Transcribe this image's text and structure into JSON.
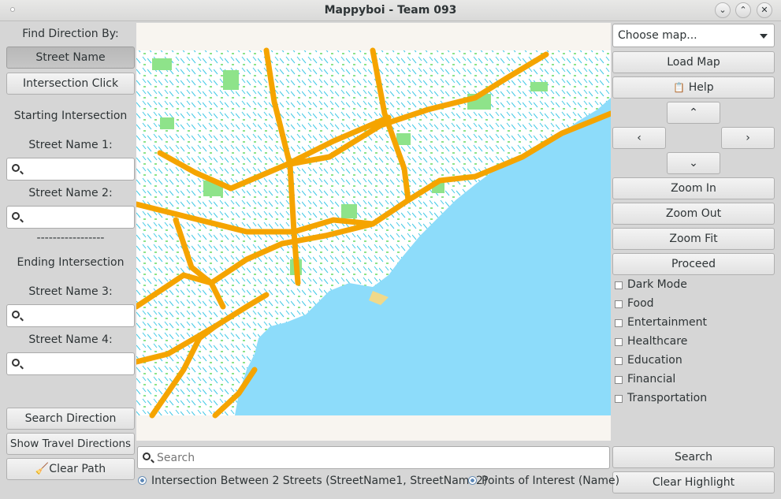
{
  "window": {
    "title": "Mappyboi - Team 093"
  },
  "left": {
    "find_by_label": "Find Direction By:",
    "street_name_btn": "Street Name",
    "intersection_click_btn": "Intersection Click",
    "starting_label": "Starting Intersection",
    "street1_label": "Street Name 1:",
    "street2_label": "Street Name 2:",
    "divider": "-----------------",
    "ending_label": "Ending Intersection",
    "street3_label": "Street Name 3:",
    "street4_label": "Street Name 4:",
    "search_direction_btn": "Search Direction",
    "show_travel_btn": "Show Travel Directions",
    "clear_path_btn": "Clear Path"
  },
  "right": {
    "map_select": "Choose map...",
    "load_map": "Load Map",
    "help": "Help",
    "zoom_in": "Zoom In",
    "zoom_out": "Zoom Out",
    "zoom_fit": "Zoom Fit",
    "proceed": "Proceed",
    "checkboxes": [
      "Dark Mode",
      "Food",
      "Entertainment",
      "Healthcare",
      "Education",
      "Financial",
      "Transportation"
    ],
    "search_btn": "Search",
    "clear_highlight": "Clear Highlight"
  },
  "bottom": {
    "search_placeholder": "Search",
    "radio1": "Intersection Between 2 Streets (StreetName1, StreetName2)",
    "radio2": "Points of Interest (Name)"
  },
  "colors": {
    "water": "#8ddcfa",
    "highway": "#f5a400",
    "park": "#8ee38a",
    "land": "#ffffff"
  }
}
